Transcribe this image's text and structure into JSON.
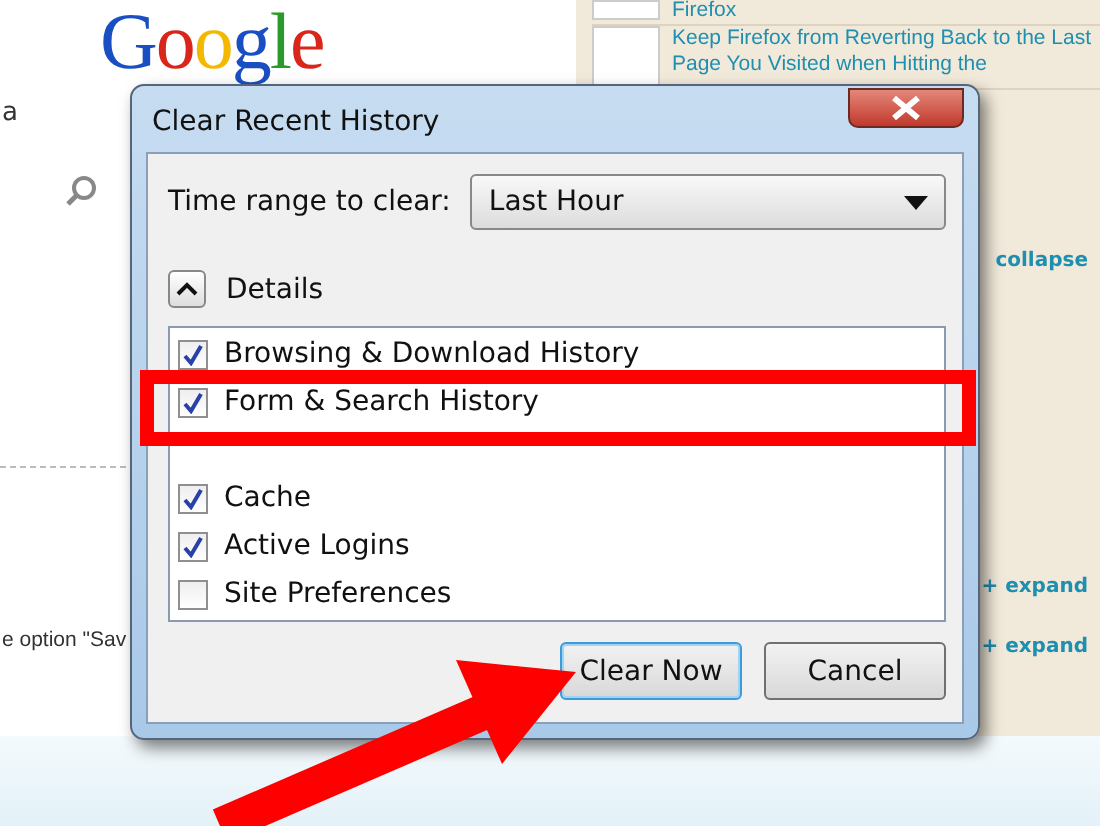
{
  "page": {
    "logo": "Google",
    "left_texts": [
      "a",
      "e option \"Sav"
    ],
    "sidebar": {
      "links": [
        "Firefox",
        "Keep Firefox from Reverting Back to the Last Page You Visited when Hitting the"
      ],
      "collapse": "collapse",
      "expands": [
        "+ expand",
        "+ expand"
      ]
    }
  },
  "dialog": {
    "title": "Clear Recent History",
    "time_range": {
      "label": "Time range to clear:",
      "value": "Last Hour"
    },
    "details": {
      "label": "Details",
      "expanded": true
    },
    "items": [
      {
        "label": "Browsing & Download History",
        "checked": true
      },
      {
        "label": "Form & Search History",
        "checked": true
      },
      {
        "label": "Cache",
        "checked": true
      },
      {
        "label": "Active Logins",
        "checked": true
      },
      {
        "label": "Site Preferences",
        "checked": false
      }
    ],
    "buttons": [
      {
        "label": "Clear Now",
        "default": true
      },
      {
        "label": "Cancel",
        "default": false
      }
    ]
  }
}
